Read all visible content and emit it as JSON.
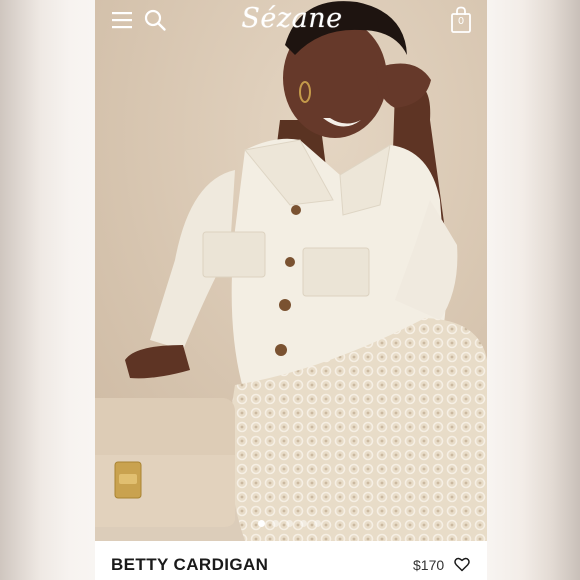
{
  "header": {
    "logo_text": "Sézane",
    "bag_count": "0",
    "icons": [
      "menu-icon",
      "search-icon",
      "shopping-bag-icon"
    ]
  },
  "hero": {
    "image_description_icon": "product-photo",
    "carousel": {
      "total": 5,
      "active_index": 0
    }
  },
  "product": {
    "name": "BETTY CARDIGAN",
    "price": "$170",
    "wishlist_icon": "heart-icon"
  },
  "colors": {
    "header_icon_color": "#ffffff",
    "text_dark": "#1a1a1a"
  }
}
